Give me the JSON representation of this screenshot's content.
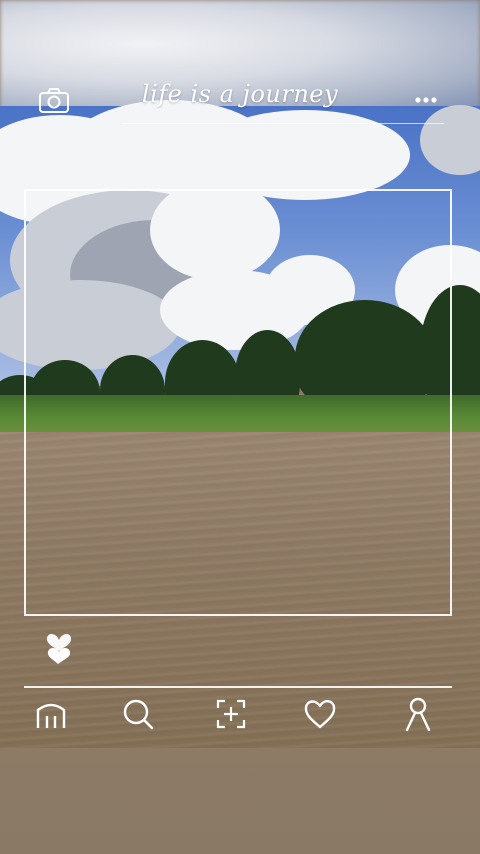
{
  "header": {
    "title": "life is a journey",
    "camera_icon": "camera-icon",
    "more_icon": "more-dots-icon"
  },
  "feed": {
    "post_icon": "heart-badge-icon"
  },
  "bottom_nav": {
    "items": [
      {
        "icon": "home-icon"
      },
      {
        "icon": "search-icon"
      },
      {
        "icon": "add-post-icon"
      },
      {
        "icon": "heart-icon"
      },
      {
        "icon": "profile-icon"
      }
    ]
  },
  "colors": {
    "ui_lines": "#ffffff",
    "sky": "#5b80cc",
    "water": "#8e7a63",
    "foliage": "#1f3a1c"
  }
}
